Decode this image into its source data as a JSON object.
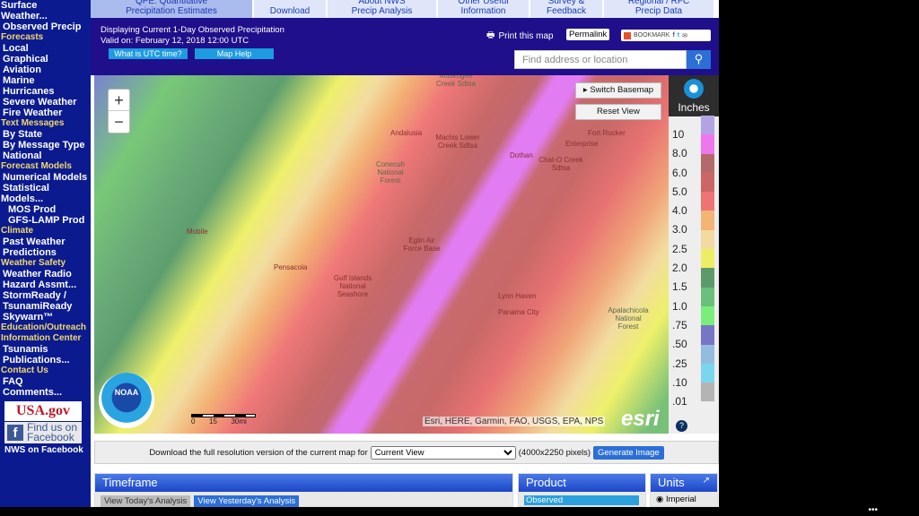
{
  "sidebar": {
    "items": [
      {
        "label": "Surface",
        "type": "top"
      },
      {
        "label": "Weather...",
        "type": "top"
      },
      {
        "label": "Observed Precip",
        "type": "item"
      },
      {
        "label": "Forecasts",
        "type": "sec"
      },
      {
        "label": "Local",
        "type": "item"
      },
      {
        "label": "Graphical",
        "type": "item"
      },
      {
        "label": "Aviation",
        "type": "item"
      },
      {
        "label": "Marine",
        "type": "item"
      },
      {
        "label": "Hurricanes",
        "type": "item"
      },
      {
        "label": "Severe Weather",
        "type": "item"
      },
      {
        "label": "Fire Weather",
        "type": "item"
      },
      {
        "label": "Text Messages",
        "type": "sec"
      },
      {
        "label": "By State",
        "type": "item"
      },
      {
        "label": "By Message Type",
        "type": "item"
      },
      {
        "label": "National",
        "type": "item"
      },
      {
        "label": "Forecast Models",
        "type": "sec"
      },
      {
        "label": "Numerical Models",
        "type": "item"
      },
      {
        "label": "Statistical",
        "type": "item"
      },
      {
        "label": "Models...",
        "type": "top"
      },
      {
        "label": "MOS Prod",
        "type": "sub2"
      },
      {
        "label": "GFS-LAMP Prod",
        "type": "sub2"
      },
      {
        "label": "Climate",
        "type": "sec"
      },
      {
        "label": "Past Weather",
        "type": "item"
      },
      {
        "label": "Predictions",
        "type": "item"
      },
      {
        "label": "Weather Safety",
        "type": "sec"
      },
      {
        "label": "Weather Radio",
        "type": "item"
      },
      {
        "label": "Hazard Assmt...",
        "type": "item"
      },
      {
        "label": "StormReady /",
        "type": "item"
      },
      {
        "label": "TsunamiReady",
        "type": "item"
      },
      {
        "label": "Skywarn™",
        "type": "item"
      },
      {
        "label": "Education/Outreach",
        "type": "sec"
      },
      {
        "label": "Information Center",
        "type": "sec"
      },
      {
        "label": "Tsunamis",
        "type": "item"
      },
      {
        "label": "Publications...",
        "type": "item"
      },
      {
        "label": "Contact Us",
        "type": "sec"
      },
      {
        "label": "FAQ",
        "type": "item"
      },
      {
        "label": "Comments...",
        "type": "item"
      }
    ],
    "usa_gov": "USA.gov",
    "facebook_find": "Find us on",
    "facebook_name": "Facebook",
    "nws_facebook": "NWS on Facebook"
  },
  "tabs": [
    {
      "l1": "QPE: Quantitative",
      "l2": "Precipitation Estimates",
      "active": true,
      "w": 180
    },
    {
      "l1": "",
      "l2": "Download",
      "w": 80
    },
    {
      "l1": "About NWS",
      "l2": "Precip Analysis",
      "w": 121
    },
    {
      "l1": "Other Useful",
      "l2": "Information",
      "w": 101
    },
    {
      "l1": "Survey &",
      "l2": "Feedback",
      "w": 80
    },
    {
      "l1": "Regional / RFC",
      "l2": "Precip Data",
      "w": 122
    }
  ],
  "header": {
    "displaying": "Displaying Current 1-Day Observed Precipitation",
    "valid": "Valid on: February 12, 2018 12:00 UTC",
    "utc_btn": "What is UTC time?",
    "help_btn": "Map Help",
    "print": "Print this map",
    "permalink": "Permalink",
    "bookmark": "BOOKMARK",
    "search_placeholder": "Find address or location"
  },
  "map": {
    "switch_basemap": "Switch Basemap",
    "reset_view": "Reset View",
    "zoom_in": "+",
    "zoom_out": "−",
    "noaa": "NOAA",
    "labels": [
      "Andalusia",
      "Fort Rucker",
      "Enterprise",
      "Machis Lower Creek Sdtsa",
      "Dothan",
      "Chat-O Creek Sdtsa",
      "Conecuh National Forest",
      "Mobile",
      "Eglin Air Force Base",
      "Pensacola",
      "Gulf Islands National Seashore",
      "Lynn Haven",
      "Panama City",
      "Apalachicola National Forest",
      "Muskogee Creek Sdtsa"
    ],
    "scale": [
      "0",
      "15",
      "30mi"
    ],
    "attribution": "Esri, HERE, Garmin, FAO, USGS, EPA, NPS",
    "esri": "esri"
  },
  "legend": {
    "title": "Inches",
    "items": [
      {
        "label": "10",
        "color": "#b3a3e3"
      },
      {
        "label": "8.0",
        "color": "#ee77ee"
      },
      {
        "label": "6.0",
        "color": "#b46a6a"
      },
      {
        "label": "5.0",
        "color": "#cc6666"
      },
      {
        "label": "4.0",
        "color": "#ee7474"
      },
      {
        "label": "3.0",
        "color": "#f3b474"
      },
      {
        "label": "2.5",
        "color": "#f3daa0"
      },
      {
        "label": "2.0",
        "color": "#eeee66"
      },
      {
        "label": "1.5",
        "color": "#5d9a6a"
      },
      {
        "label": "1.0",
        "color": "#6ac07a"
      },
      {
        "label": ".75",
        "color": "#7aee7a"
      },
      {
        "label": ".50",
        "color": "#7676c6"
      },
      {
        "label": ".25",
        "color": "#94bce0"
      },
      {
        "label": ".10",
        "color": "#7ad6ee"
      },
      {
        "label": ".01",
        "color": "#b4b4b4"
      }
    ]
  },
  "download": {
    "text": "Download the full resolution version of the current map for",
    "selected": "Current View",
    "pixels": "(4000x2250 pixels)",
    "button": "Generate Image"
  },
  "panels": {
    "timeframe": "Timeframe",
    "today": "View Today's Analysis",
    "yesterday": "View Yesterday's Analysis",
    "product": "Product",
    "observed": "Observed",
    "units": "Units",
    "imperial": "Imperial"
  }
}
